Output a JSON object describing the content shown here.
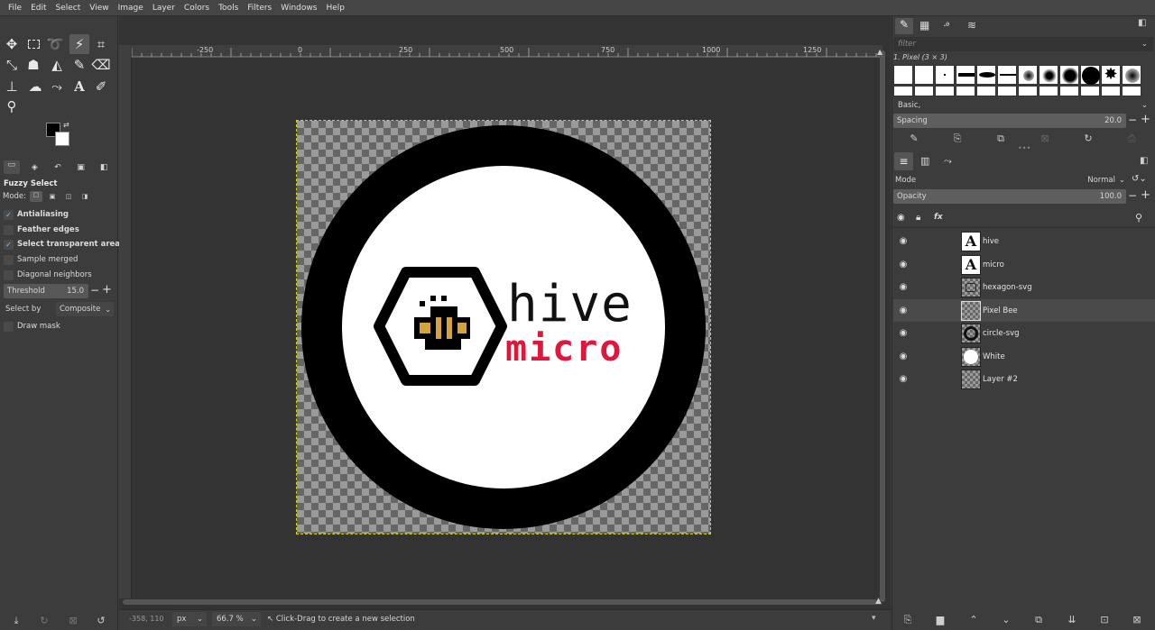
{
  "menu": [
    "File",
    "Edit",
    "Select",
    "View",
    "Image",
    "Layer",
    "Colors",
    "Tools",
    "Filters",
    "Windows",
    "Help"
  ],
  "tool_options": {
    "title": "Fuzzy Select",
    "mode_label": "Mode:",
    "antialiasing": "Antialiasing",
    "feather_edges": "Feather edges",
    "select_transparent": "Select transparent areas",
    "sample_merged": "Sample merged",
    "diagonal_neighbors": "Diagonal neighbors",
    "threshold_label": "Threshold",
    "threshold_value": "15.0",
    "select_by_label": "Select by",
    "select_by_value": "Composite",
    "draw_mask": "Draw mask"
  },
  "ruler": {
    "h_labels": [
      "-250",
      "0",
      "250",
      "500",
      "750",
      "1000",
      "1250"
    ]
  },
  "logo": {
    "word1": "hive",
    "word2": "micro",
    "accent": "#e0173c",
    "bee": "#d4a33b"
  },
  "brushes": {
    "filter_placeholder": "filter",
    "current": "1. Pixel (3 × 3)",
    "preset": "Basic,",
    "spacing_label": "Spacing",
    "spacing_value": "20.0"
  },
  "layers": {
    "mode_label": "Mode",
    "mode_value": "Normal",
    "opacity_label": "Opacity",
    "opacity_value": "100.0",
    "items": [
      {
        "name": "hive",
        "type": "text"
      },
      {
        "name": "micro",
        "type": "text"
      },
      {
        "name": "hexagon-svg",
        "type": "hex"
      },
      {
        "name": "Pixel Bee",
        "type": "checker",
        "selected": true
      },
      {
        "name": "circle-svg",
        "type": "circle"
      },
      {
        "name": "White",
        "type": "white"
      },
      {
        "name": "Layer #2",
        "type": "checker"
      }
    ]
  },
  "status": {
    "coords": "-358, 110",
    "unit": "px",
    "zoom": "66.7 %",
    "message": "Click-Drag to create a new selection"
  }
}
